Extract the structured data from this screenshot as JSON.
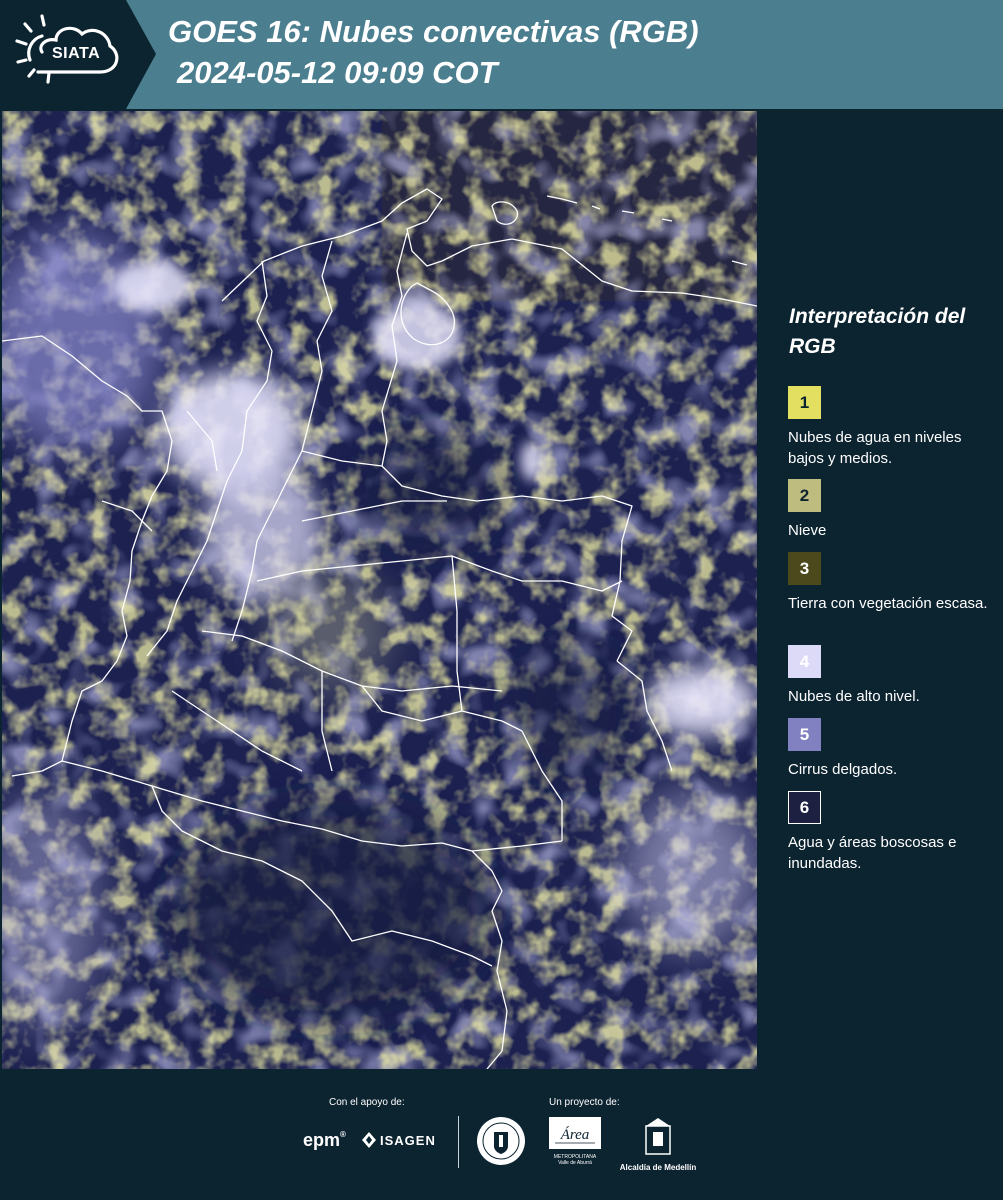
{
  "header": {
    "logo_text": "SIATA",
    "title_line1": "GOES 16: Nubes convectivas (RGB)",
    "title_line2": "2024-05-12 09:09 COT",
    "background_color": "#4b7f8f",
    "logo_panel_color": "#0c2330"
  },
  "legend": {
    "title": "Interpretación del RGB",
    "items": [
      {
        "number": "1",
        "label": "Nubes de agua en niveles bajos y medios.",
        "color": "#e3df60"
      },
      {
        "number": "2",
        "label": "Nieve",
        "color": "#bebc7e"
      },
      {
        "number": "3",
        "label": "Tierra con vegetación escasa.",
        "color": "#4c4a1d"
      },
      {
        "number": "4",
        "label": "Nubes de alto nivel.",
        "color": "#dcdaf6"
      },
      {
        "number": "5",
        "label": "Cirrus delgados.",
        "color": "#8181c1"
      },
      {
        "number": "6",
        "label": "Agua y áreas boscosas e inundadas.",
        "color": "#1e2042"
      }
    ]
  },
  "footer": {
    "support_label": "Con el apoyo de:",
    "project_label": "Un proyecto de:",
    "epm": "epm",
    "isagen": "ISAGEN",
    "area_metro_script": "Área",
    "area_metro_name": "METROPOLITANA Valle de Aburrá",
    "alcaldia": "Alcaldía de Medellín"
  },
  "colors": {
    "panel": "#0c2330",
    "map_background": "#1c2150",
    "boundary": "#ffffff"
  },
  "icons": [
    "sun-cloud-icon",
    "isagen-icon",
    "medellin-seal-icon",
    "alcaldia-building-icon"
  ]
}
